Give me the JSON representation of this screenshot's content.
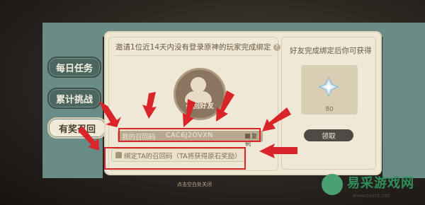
{
  "nav": {
    "items": [
      {
        "label": "每日任务"
      },
      {
        "label": "累计挑战"
      },
      {
        "label": "有奖召回"
      }
    ]
  },
  "invite": {
    "title": "邀请1位近14天内没有登录原神的玩家完成绑定",
    "avatar_label": "召回好友",
    "code_label": "我的召回码",
    "code_value": "CAC6J2OVXN",
    "copy_label": "复制",
    "bind_label": "绑定TA的召回码（TA将获得原石奖励）"
  },
  "reward": {
    "title": "好友完成绑定后你可获得",
    "count": "80",
    "claim_label": "领取"
  },
  "footer": {
    "hint": "点击空白处关闭"
  },
  "watermark": {
    "title": "易采游戏网",
    "url": "www.caxck.net"
  },
  "colors": {
    "teal": "#6a8c86",
    "card": "#f0e8d6",
    "annotation_red": "#d9242a"
  }
}
